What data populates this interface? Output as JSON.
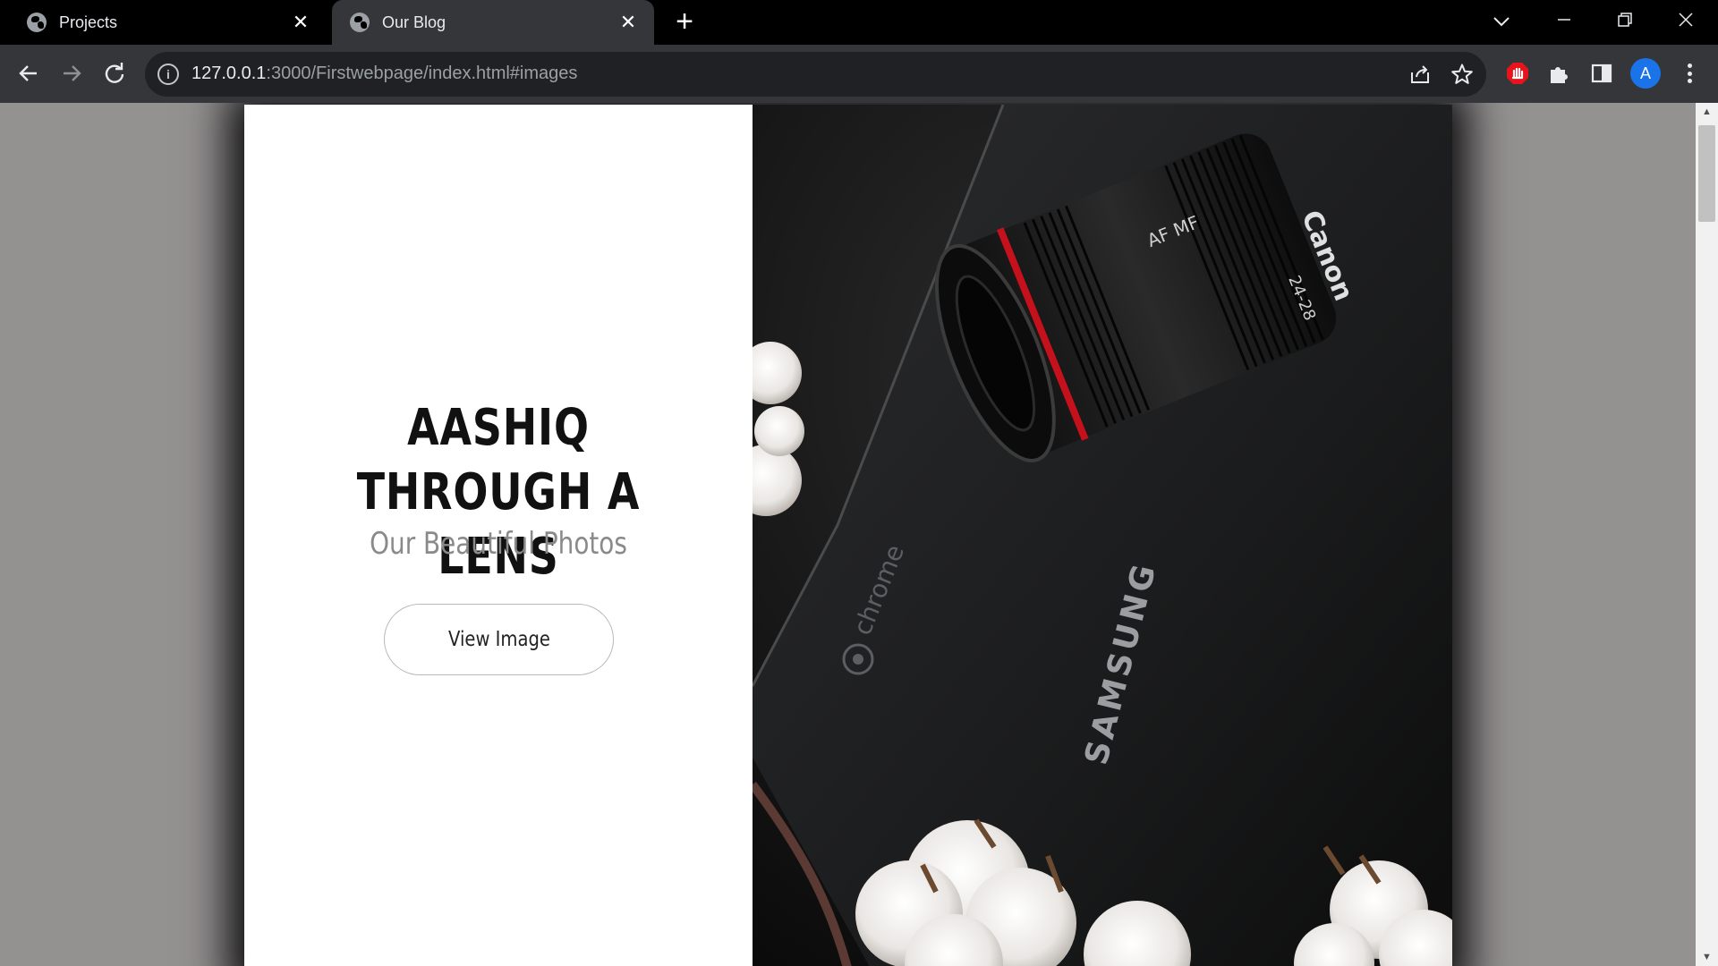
{
  "browser": {
    "tabs": [
      {
        "title": "Projects",
        "active": false
      },
      {
        "title": "Our Blog",
        "active": true
      }
    ],
    "address": {
      "host": "127.0.0.1",
      "path": ":3000/Firstwebpage/index.html#images"
    },
    "profile_initial": "A",
    "accent_color": "#1a73e8"
  },
  "page": {
    "title_line1": "AASHIQ THROUGH A",
    "title_line2": "LENS",
    "subtitle": "Our Beautiful Photos",
    "button_label": "View Image",
    "photo_text": {
      "brand_laptop": "SAMSUNG",
      "brand_os": "chrome",
      "brand_lens": "Canon",
      "lens_mode": "AF  MF",
      "lens_spec": "24-28"
    }
  },
  "icons": [
    "globe-icon",
    "close-icon",
    "plus-icon",
    "chevron-down-icon",
    "minimize-icon",
    "maximize-icon",
    "back-arrow-icon",
    "forward-arrow-icon",
    "reload-icon",
    "info-icon",
    "share-icon",
    "star-icon",
    "adblock-icon",
    "puzzle-icon",
    "side-panel-icon",
    "kebab-menu-icon"
  ]
}
